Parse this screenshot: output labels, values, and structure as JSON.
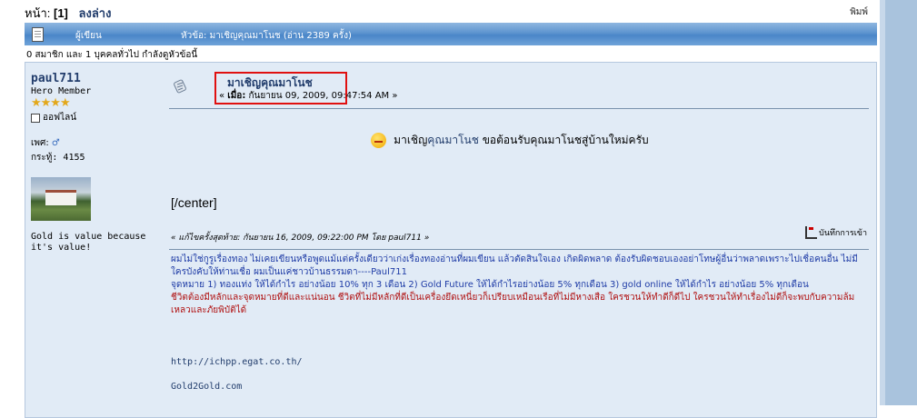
{
  "pagebar": {
    "pages_label": "หน้า:",
    "current_page": "[1]",
    "go_bottom": "ลงล่าง",
    "print": "พิมพ์"
  },
  "catbar": {
    "author_label": "ผู้เขียน",
    "topic_label": "หัวข้อ: มาเชิญคุณมาโนช  (อ่าน 2389 ครั้ง)"
  },
  "readers": "0 สมาชิก และ 1 บุคคลทั่วไป กำลังดูหัวข้อนี้",
  "poster": {
    "name": "paul711",
    "rank": "Hero Member",
    "stars": "★★★★",
    "status": "ออฟไลน์",
    "gender_label": "เพศ:",
    "gender_symbol": "♂",
    "posts": "กระทู้: 4155",
    "signature": "Gold is value because it's value!"
  },
  "post": {
    "subject": "มาเชิญคุณมาโนช",
    "date_prefix": "« ",
    "date_label": "เมื่อ:",
    "date": " กันยายน 09, 2009, 09:47:54 AM »",
    "greeting_before": "มาเชิญ",
    "greeting_link": "คุณมาโนช",
    "greeting_after": " ขอต้อนรับคุณมาโนชสู่บ้านใหม่ครับ",
    "center_close": "[/center]",
    "last_edit": "« แก้ไขครั้งสุดท้าย: กันยายน 16, 2009, 09:22:00 PM โดย paul711 »",
    "report": "บันทึกการเข้า"
  },
  "signature_block": {
    "line1": "ผมไม่ใช่กูรูเรื่องทอง ไม่เคยเขียนหรือพูดแม้แต่ครั้งเดียวว่าเก่งเรื่องทองอ่านที่ผมเขียน แล้วตัดสินใจเอง เกิดผิดพลาด ต้องรับผิดชอบเองอย่าโทษผู้อื่นว่าพลาดเพราะไปเชื่อคนอื่น ไม่มีใครบังคับให้ท่านเชื่อ ผมเป็นแค่ชาวบ้านธรรมดา----Paul711",
    "line2": "จุดหมาย 1) ทองแท่ง ให้ได้กำไร อย่างน้อย 10% ทุก 3 เดือน 2) Gold Future ให้ได้กำไรอย่างน้อย 5% ทุกเดือน 3) gold online ให้ได้กำไร อย่างน้อย 5% ทุกเดือน",
    "line3": "ชีวิตต้องมีหลักและจุดหมายที่ดีและแน่นอน ชีวิตที่ไม่มีหลักที่ดีเป็นเครื่องยึดเหนี่ยวก็เปรียบเหมือนเรือที่ไม่มีหางเสือ ใครชวนให้ทำดีก็ดีไป ใครชวนให้ทำเรื่องไม่ดีก็จะพบกับความล้มเหลวและภัยพิบัติได้"
  },
  "links": {
    "link1": "http://ichpp.egat.co.th/",
    "link2": "Gold2Gold.com"
  },
  "colors": {
    "header_blue": "#4a86c8",
    "post_bg": "#e1ebf6",
    "highlight_red": "#e01010",
    "link": "#223d6c"
  }
}
